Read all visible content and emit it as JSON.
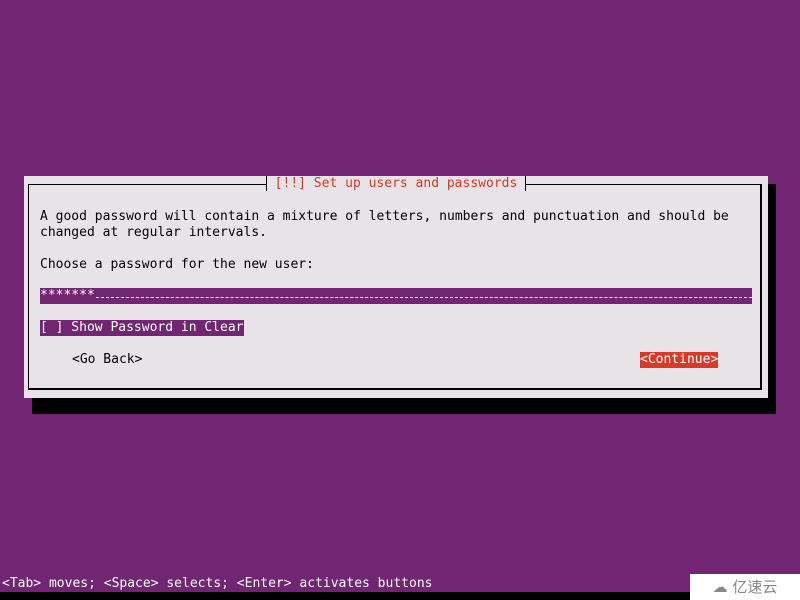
{
  "dialog": {
    "title": "[!!] Set up users and passwords",
    "description_line1": "A good password will contain a mixture of letters, numbers and punctuation and should be",
    "description_line2": "changed at regular intervals.",
    "prompt": "Choose a password for the new user:",
    "password_value": "*******",
    "show_password_checkbox": "[ ] Show Password in Clear",
    "show_password_checked": false,
    "go_back_label": "<Go Back>",
    "continue_label": "<Continue>"
  },
  "status_bar": "<Tab> moves; <Space> selects; <Enter> activates buttons",
  "watermark": "亿速云",
  "colors": {
    "background": "#712573",
    "dialog": "#e8e3e6",
    "title": "#d03a2a",
    "focus_button": "#d83a28"
  }
}
